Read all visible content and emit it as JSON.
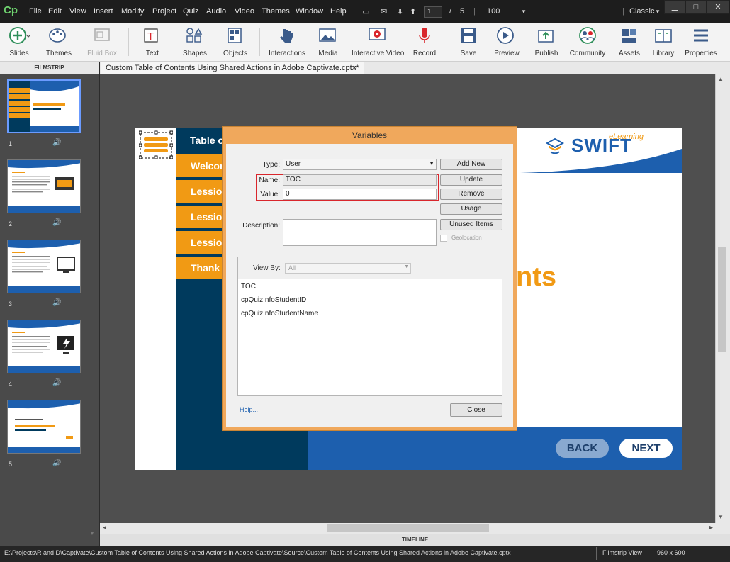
{
  "app": {
    "logo": "Cp",
    "menu": [
      "File",
      "Edit",
      "View",
      "Insert",
      "Modify",
      "Project",
      "Quiz",
      "Audio",
      "Video",
      "Themes",
      "Window",
      "Help"
    ],
    "page_current": "1",
    "page_sep": "/",
    "page_total": "5",
    "zoom": "100",
    "workspace": "Classic"
  },
  "toolbar": {
    "items": [
      "Slides",
      "Themes",
      "Fluid Box",
      "Text",
      "Shapes",
      "Objects",
      "Interactions",
      "Media",
      "Interactive Video",
      "Record",
      "Save",
      "Preview",
      "Publish",
      "Community",
      "Assets",
      "Library",
      "Properties"
    ]
  },
  "filmstrip": {
    "header": "FILMSTRIP",
    "slides": [
      "1",
      "2",
      "3",
      "4",
      "5"
    ]
  },
  "document": {
    "tab_title": "Custom Table of Contents Using Shared Actions in Adobe Captivate.cptx*",
    "close": "×"
  },
  "slide": {
    "toc_title": "Table o",
    "toc_items": [
      "Welcom",
      "Lession",
      "Lession",
      "Lession",
      "Thank"
    ],
    "brand": "SWIFT",
    "brand_sub": "eLearning",
    "big_text": "nts",
    "back": "BACK",
    "next": "NEXT"
  },
  "dialog": {
    "title": "Variables",
    "type_label": "Type:",
    "type_value": "User",
    "name_label": "Name:",
    "name_value": "TOC",
    "value_label": "Value:",
    "value_value": "0",
    "description_label": "Description:",
    "geolocation": "Geolocation",
    "buttons": {
      "add_new": "Add New",
      "update": "Update",
      "remove": "Remove",
      "usage": "Usage",
      "unused": "Unused Items",
      "close": "Close"
    },
    "view_by_label": "View By:",
    "view_by_value": "All",
    "variables": [
      "TOC",
      "cpQuizInfoStudentID",
      "cpQuizInfoStudentName"
    ],
    "help": "Help..."
  },
  "timeline": "TIMELINE",
  "status": {
    "path": "E:\\Projects\\R and D\\Captivate\\Custom Table of Contents Using Shared Actions in Adobe Captivate\\Source\\Custom Table of Contents Using Shared Actions in Adobe Captivate.cptx",
    "view": "Filmstrip View",
    "size": "960 x 600"
  },
  "colors": {
    "accent_orange": "#f19a14",
    "navy": "#003a5d",
    "blue": "#1d5fae",
    "highlight_red": "#d9262c"
  }
}
